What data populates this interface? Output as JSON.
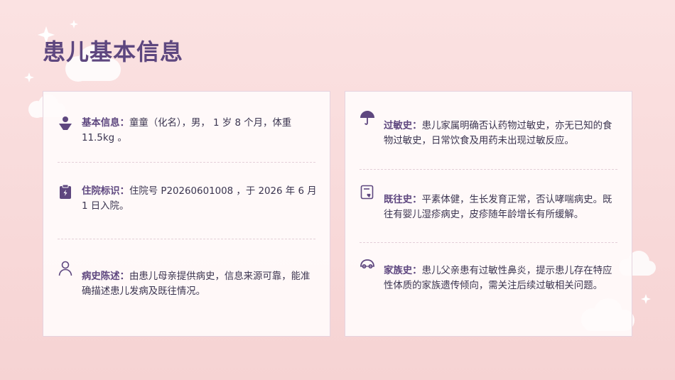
{
  "page": {
    "title": "患儿基本信息",
    "colors": {
      "accent": "#5e477f",
      "background": "#fbe2e2",
      "card": "#fffbfb"
    }
  },
  "left_card": {
    "items": [
      {
        "icon": "person-icon",
        "label": "基本信息：",
        "text": "童童（化名），男， 1 岁 8 个月，体重 11.5kg 。"
      },
      {
        "icon": "clipboard-icon",
        "label": "住院标识：",
        "text": "住院号  P20260601008 ，于 2026 年 6 月 1 日入院。"
      },
      {
        "icon": "user-icon",
        "label": "病史陈述：",
        "text": "由患儿母亲提供病史，信息来源可靠，能准确描述患儿发病及既往情况。"
      }
    ]
  },
  "right_card": {
    "items": [
      {
        "icon": "umbrella-icon",
        "label": "过敏史：",
        "text": "患儿家属明确否认药物过敏史，亦无已知的食物过敏史，日常饮食及用药未出现过敏反应。"
      },
      {
        "icon": "medical-record-icon",
        "label": "既往史：",
        "text": "平素体健，生长发育正常，否认哮喘病史。既往有婴儿湿疹病史，皮疹随年龄增长有所缓解。"
      },
      {
        "icon": "family-icon",
        "label": "家族史：",
        "text": "患儿父亲患有过敏性鼻炎，提示患儿存在特应性体质的家族遗传倾向，需关注后续过敏相关问题。"
      }
    ]
  }
}
